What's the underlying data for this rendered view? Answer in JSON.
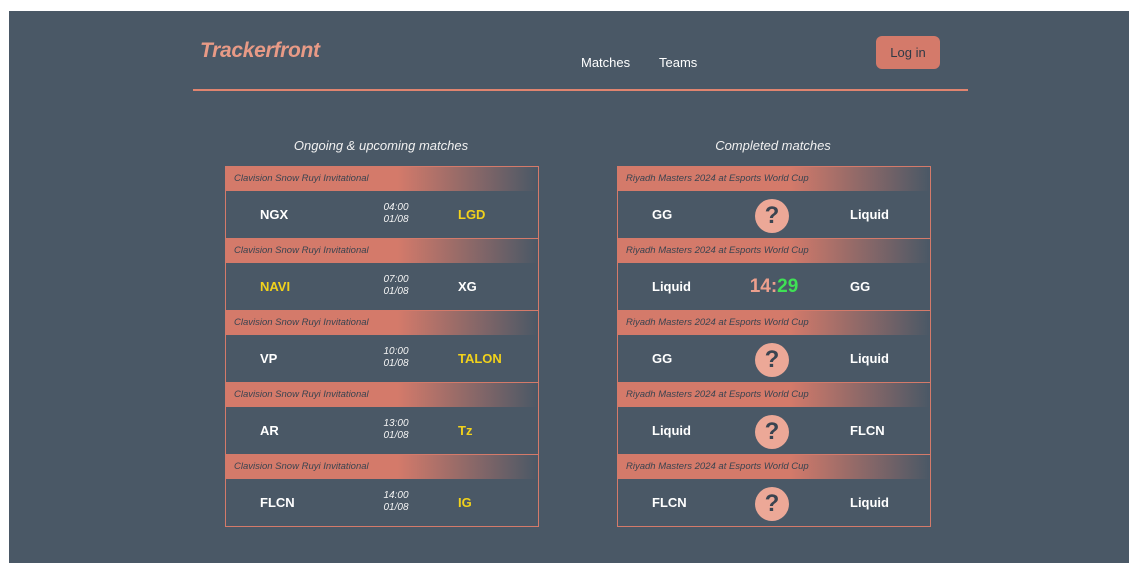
{
  "header": {
    "logo": "Trackerfront",
    "nav": [
      "Matches",
      "Teams"
    ],
    "login_label": "Log in"
  },
  "upcoming": {
    "title": "Ongoing & upcoming matches",
    "matches": [
      {
        "tournament": "Clavision Snow Ruyi Invitational",
        "team1": "NGX",
        "team2": "LGD",
        "time": "04:00",
        "date": "01/08",
        "highlight": 2
      },
      {
        "tournament": "Clavision Snow Ruyi Invitational",
        "team1": "NAVI",
        "team2": "XG",
        "time": "07:00",
        "date": "01/08",
        "highlight": 1
      },
      {
        "tournament": "Clavision Snow Ruyi Invitational",
        "team1": "VP",
        "team2": "TALON",
        "time": "10:00",
        "date": "01/08",
        "highlight": 2
      },
      {
        "tournament": "Clavision Snow Ruyi Invitational",
        "team1": "AR",
        "team2": "Tz",
        "time": "13:00",
        "date": "01/08",
        "highlight": 2
      },
      {
        "tournament": "Clavision Snow Ruyi Invitational",
        "team1": "FLCN",
        "team2": "IG",
        "time": "14:00",
        "date": "01/08",
        "highlight": 2
      }
    ]
  },
  "completed": {
    "title": "Completed matches",
    "matches": [
      {
        "tournament": "Riyadh Masters 2024 at Esports World Cup",
        "team1": "GG",
        "team2": "Liquid",
        "result": "?"
      },
      {
        "tournament": "Riyadh Masters 2024 at Esports World Cup",
        "team1": "Liquid",
        "team2": "GG",
        "score1": "14",
        "separator": ":",
        "score2": "29"
      },
      {
        "tournament": "Riyadh Masters 2024 at Esports World Cup",
        "team1": "GG",
        "team2": "Liquid",
        "result": "?"
      },
      {
        "tournament": "Riyadh Masters 2024 at Esports World Cup",
        "team1": "Liquid",
        "team2": "FLCN",
        "result": "?"
      },
      {
        "tournament": "Riyadh Masters 2024 at Esports World Cup",
        "team1": "FLCN",
        "team2": "Liquid",
        "result": "?"
      }
    ]
  },
  "colors": {
    "background": "#4a5866",
    "accent": "#d47a6a",
    "highlight_team": "#f2d21b",
    "winning_score": "#3fe055"
  }
}
